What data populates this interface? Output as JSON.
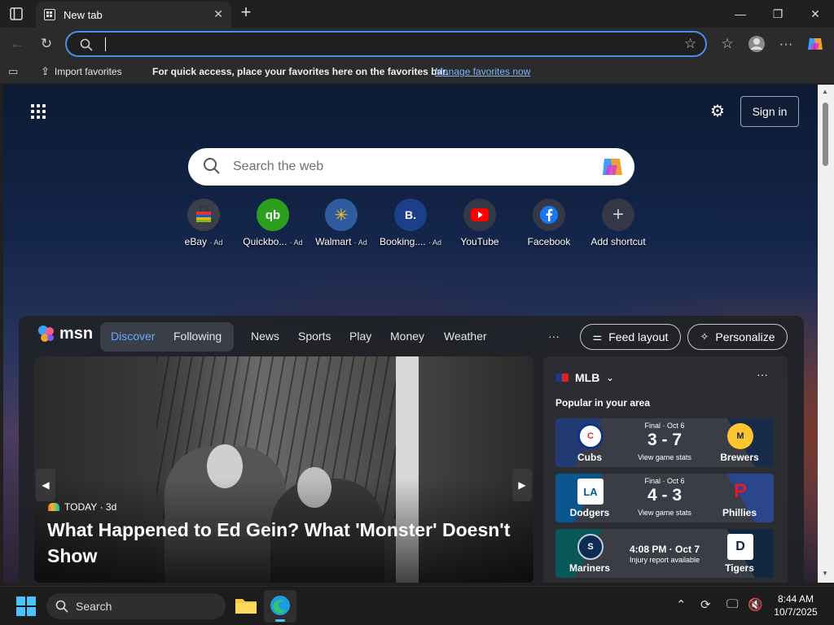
{
  "tab": {
    "title": "New tab"
  },
  "address": {
    "value": ""
  },
  "favorites_bar": {
    "import_label": "Import favorites",
    "hint": "For quick access, place your favorites here on the favorites bar.",
    "manage_link": "Manage favorites now"
  },
  "newtab": {
    "signin_label": "Sign in",
    "search_placeholder": "Search the web",
    "shortcuts": [
      {
        "label": "eBay",
        "ad": "· Ad",
        "icon": "ebay-icon",
        "glyph": "🛍"
      },
      {
        "label": "Quickbo...",
        "ad": "· Ad",
        "icon": "quickbooks-icon",
        "glyph": "qb"
      },
      {
        "label": "Walmart",
        "ad": "· Ad",
        "icon": "walmart-icon",
        "glyph": "✳"
      },
      {
        "label": "Booking....",
        "ad": "· Ad",
        "icon": "booking-icon",
        "glyph": "B."
      },
      {
        "label": "YouTube",
        "ad": "",
        "icon": "youtube-icon",
        "glyph": "▶"
      },
      {
        "label": "Facebook",
        "ad": "",
        "icon": "facebook-icon",
        "glyph": "f"
      },
      {
        "label": "Add shortcut",
        "ad": "",
        "icon": "plus-icon",
        "glyph": "+"
      }
    ]
  },
  "msn": {
    "logo": "msn",
    "tabs": {
      "discover": "Discover",
      "following": "Following"
    },
    "nav": [
      "News",
      "Sports",
      "Play",
      "Money",
      "Weather"
    ],
    "more": "···",
    "feed_layout": "Feed layout",
    "personalize": "Personalize",
    "hero": {
      "source": "TODAY",
      "age": "· 3d",
      "headline": "What Happened to Ed Gein? What 'Monster' Doesn't Show"
    },
    "mlb": {
      "title": "MLB",
      "more": "···",
      "subtitle": "Popular in your area",
      "games": [
        {
          "home": "Cubs",
          "away": "Brewers",
          "status": "Final · Oct 6",
          "score": "3 - 7",
          "link": "View game stats",
          "home_logo": "C",
          "away_logo": "M"
        },
        {
          "home": "Dodgers",
          "away": "Phillies",
          "status": "Final · Oct 6",
          "score": "4 - 3",
          "link": "View game stats",
          "home_logo": "LA",
          "away_logo": "P"
        },
        {
          "home": "Mariners",
          "away": "Tigers",
          "time": "4:08 PM · Oct 7",
          "note": "Injury report available",
          "home_logo": "S",
          "away_logo": "D"
        }
      ]
    }
  },
  "taskbar": {
    "search_label": "Search",
    "time": "8:44 AM",
    "date": "10/7/2025"
  }
}
